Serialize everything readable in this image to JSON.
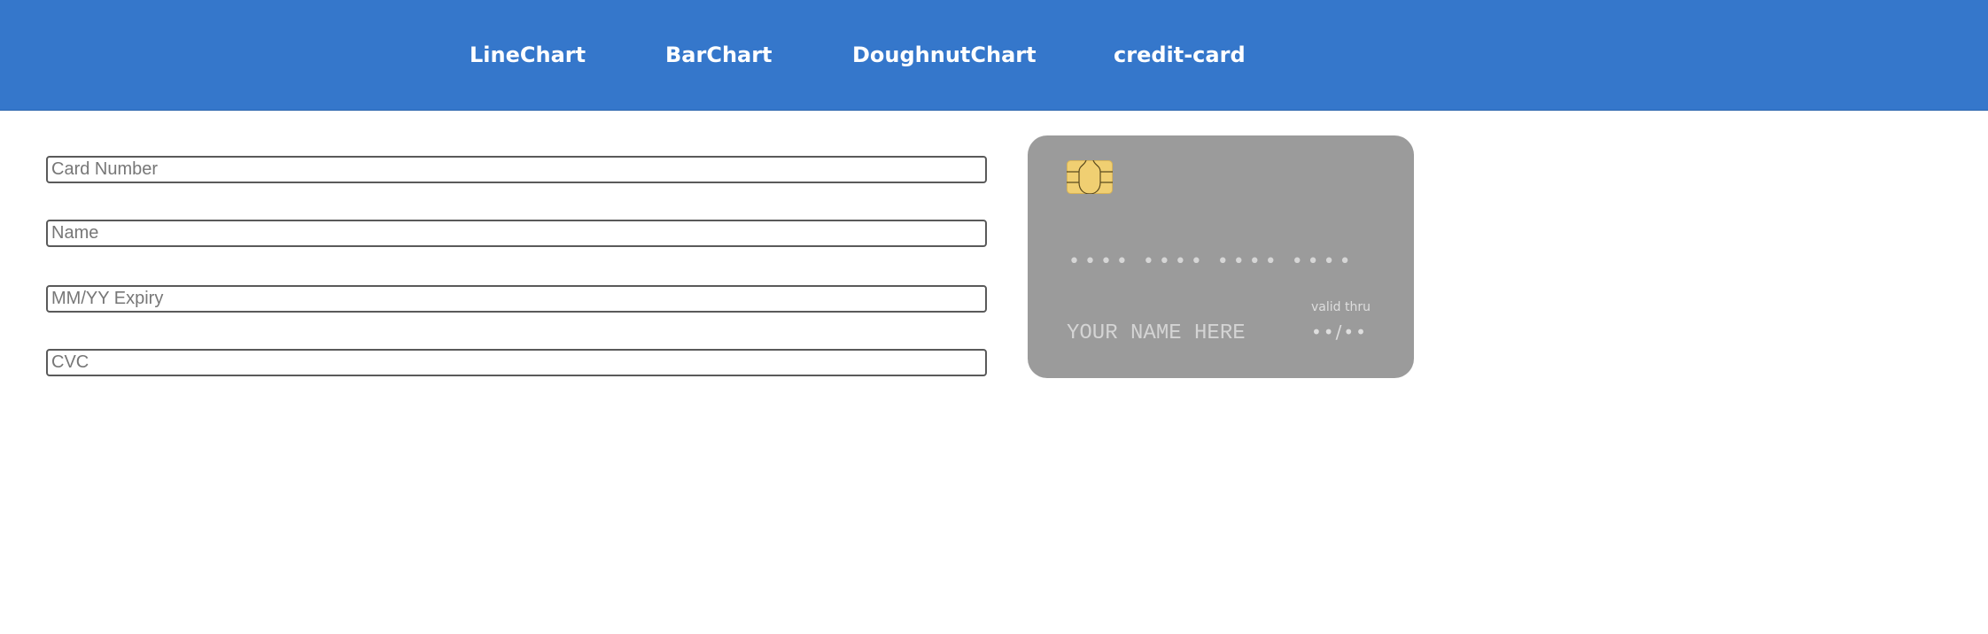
{
  "nav": {
    "items": [
      {
        "label": "LineChart"
      },
      {
        "label": "BarChart"
      },
      {
        "label": "DoughnutChart"
      },
      {
        "label": "credit-card"
      }
    ]
  },
  "form": {
    "card_number": {
      "placeholder": "Card Number",
      "value": ""
    },
    "name": {
      "placeholder": "Name",
      "value": ""
    },
    "expiry": {
      "placeholder": "MM/YY Expiry",
      "value": ""
    },
    "cvc": {
      "placeholder": "CVC",
      "value": ""
    }
  },
  "card": {
    "number": "•••• •••• •••• ••••",
    "name": "YOUR NAME HERE",
    "valid_thru_label": "valid thru",
    "expiry": "••/••",
    "background_color": "#9b9b9b",
    "chip_color": "#f0cf72"
  },
  "colors": {
    "header": "#3577cb"
  }
}
